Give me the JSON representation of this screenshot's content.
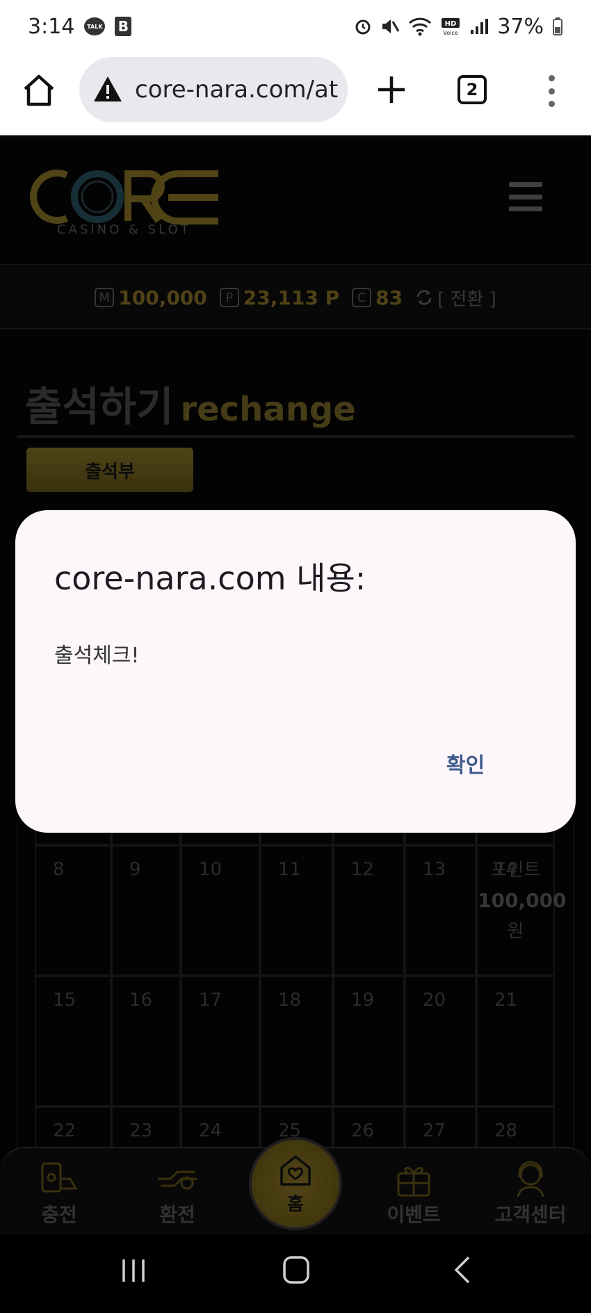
{
  "status_bar": {
    "time": "3:14",
    "talk_badge": "TALK",
    "b_badge": "B",
    "battery": "37%"
  },
  "browser": {
    "url": "core-nara.com/at",
    "tab_count": "2"
  },
  "site": {
    "logo_text": "CORE",
    "logo_subtitle": "CASINO & SLOT",
    "points": {
      "m_icon": "M",
      "money": "100,000",
      "p_icon": "P",
      "point": "23,113 P",
      "c_icon": "C",
      "coin": "83",
      "switch_label": "[ 전환 ]"
    },
    "page_title": "출석하기",
    "page_subtitle": "rechange",
    "attendance_button": "출석부",
    "calendar": {
      "rows": [
        [
          "8",
          "9",
          "10",
          "11",
          "12",
          "13",
          "14"
        ],
        [
          "15",
          "16",
          "17",
          "18",
          "19",
          "20",
          "21"
        ],
        [
          "22",
          "23",
          "24",
          "25",
          "26",
          "27",
          "28"
        ]
      ],
      "bonus_label": "포인트",
      "bonus_amount": "100,000",
      "bonus_unit": "원"
    },
    "bottom_nav": [
      {
        "label": "충전",
        "icon": "charge-icon"
      },
      {
        "label": "환전",
        "icon": "exchange-icon"
      },
      {
        "label": "홈",
        "icon": "home-heart-icon"
      },
      {
        "label": "이벤트",
        "icon": "gift-icon"
      },
      {
        "label": "고객센터",
        "icon": "support-icon"
      }
    ]
  },
  "dialog": {
    "title": "core-nara.com 내용:",
    "message": "출석체크!",
    "ok_label": "확인"
  },
  "colors": {
    "gold": "#6b5a20",
    "dialog_bg": "#fdf7fb",
    "ok_text": "#3f5a8a"
  }
}
